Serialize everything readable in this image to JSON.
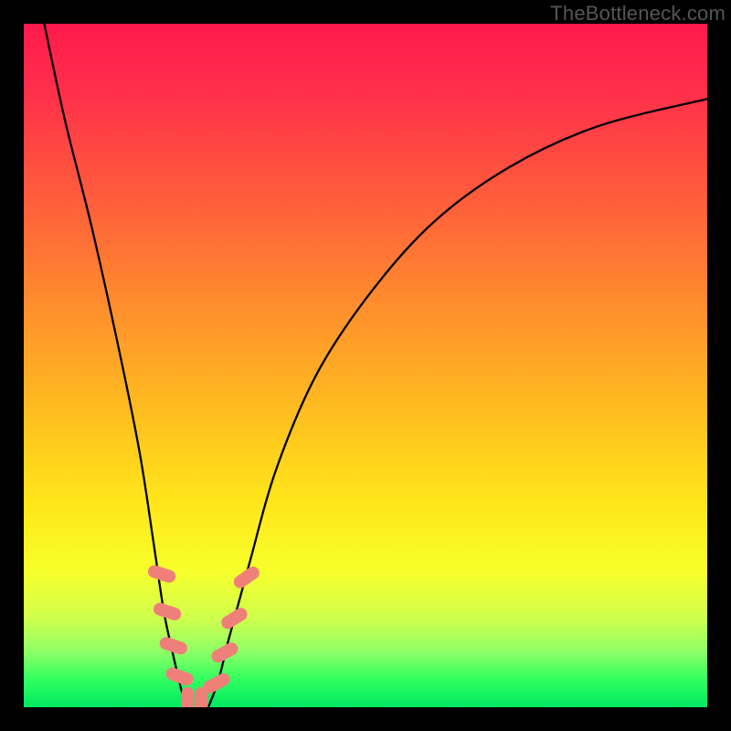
{
  "watermark": "TheBottleneck.com",
  "chart_data": {
    "type": "line",
    "title": "",
    "xlabel": "",
    "ylabel": "",
    "xlim": [
      0,
      100
    ],
    "ylim": [
      0,
      100
    ],
    "series": [
      {
        "name": "left-curve",
        "x": [
          3,
          6,
          10,
          14,
          17,
          19,
          20.5,
          22,
          23.2,
          24
        ],
        "y": [
          100,
          86,
          70,
          52,
          37,
          24,
          14,
          7,
          2,
          0
        ]
      },
      {
        "name": "right-curve",
        "x": [
          27,
          28.5,
          30,
          33,
          37,
          43,
          51,
          60,
          71,
          84,
          100
        ],
        "y": [
          0,
          4,
          10,
          21,
          35,
          49,
          61,
          71,
          79,
          85,
          89
        ]
      }
    ],
    "markers": [
      {
        "name": "marker-left-1",
        "cx": 20.2,
        "cy": 19.5,
        "rot": -72
      },
      {
        "name": "marker-left-2",
        "cx": 21.0,
        "cy": 14.0,
        "rot": -72
      },
      {
        "name": "marker-left-3",
        "cx": 21.9,
        "cy": 9.0,
        "rot": -72
      },
      {
        "name": "marker-left-4",
        "cx": 22.8,
        "cy": 4.5,
        "rot": -70
      },
      {
        "name": "marker-bottom-1",
        "cx": 24.0,
        "cy": 0.9,
        "rot": 0
      },
      {
        "name": "marker-bottom-2",
        "cx": 26.0,
        "cy": 0.9,
        "rot": 0
      },
      {
        "name": "marker-right-1",
        "cx": 28.2,
        "cy": 3.5,
        "rot": 62
      },
      {
        "name": "marker-right-2",
        "cx": 29.4,
        "cy": 8.0,
        "rot": 62
      },
      {
        "name": "marker-right-3",
        "cx": 30.8,
        "cy": 13.0,
        "rot": 58
      },
      {
        "name": "marker-right-4",
        "cx": 32.6,
        "cy": 19.0,
        "rot": 55
      }
    ]
  }
}
